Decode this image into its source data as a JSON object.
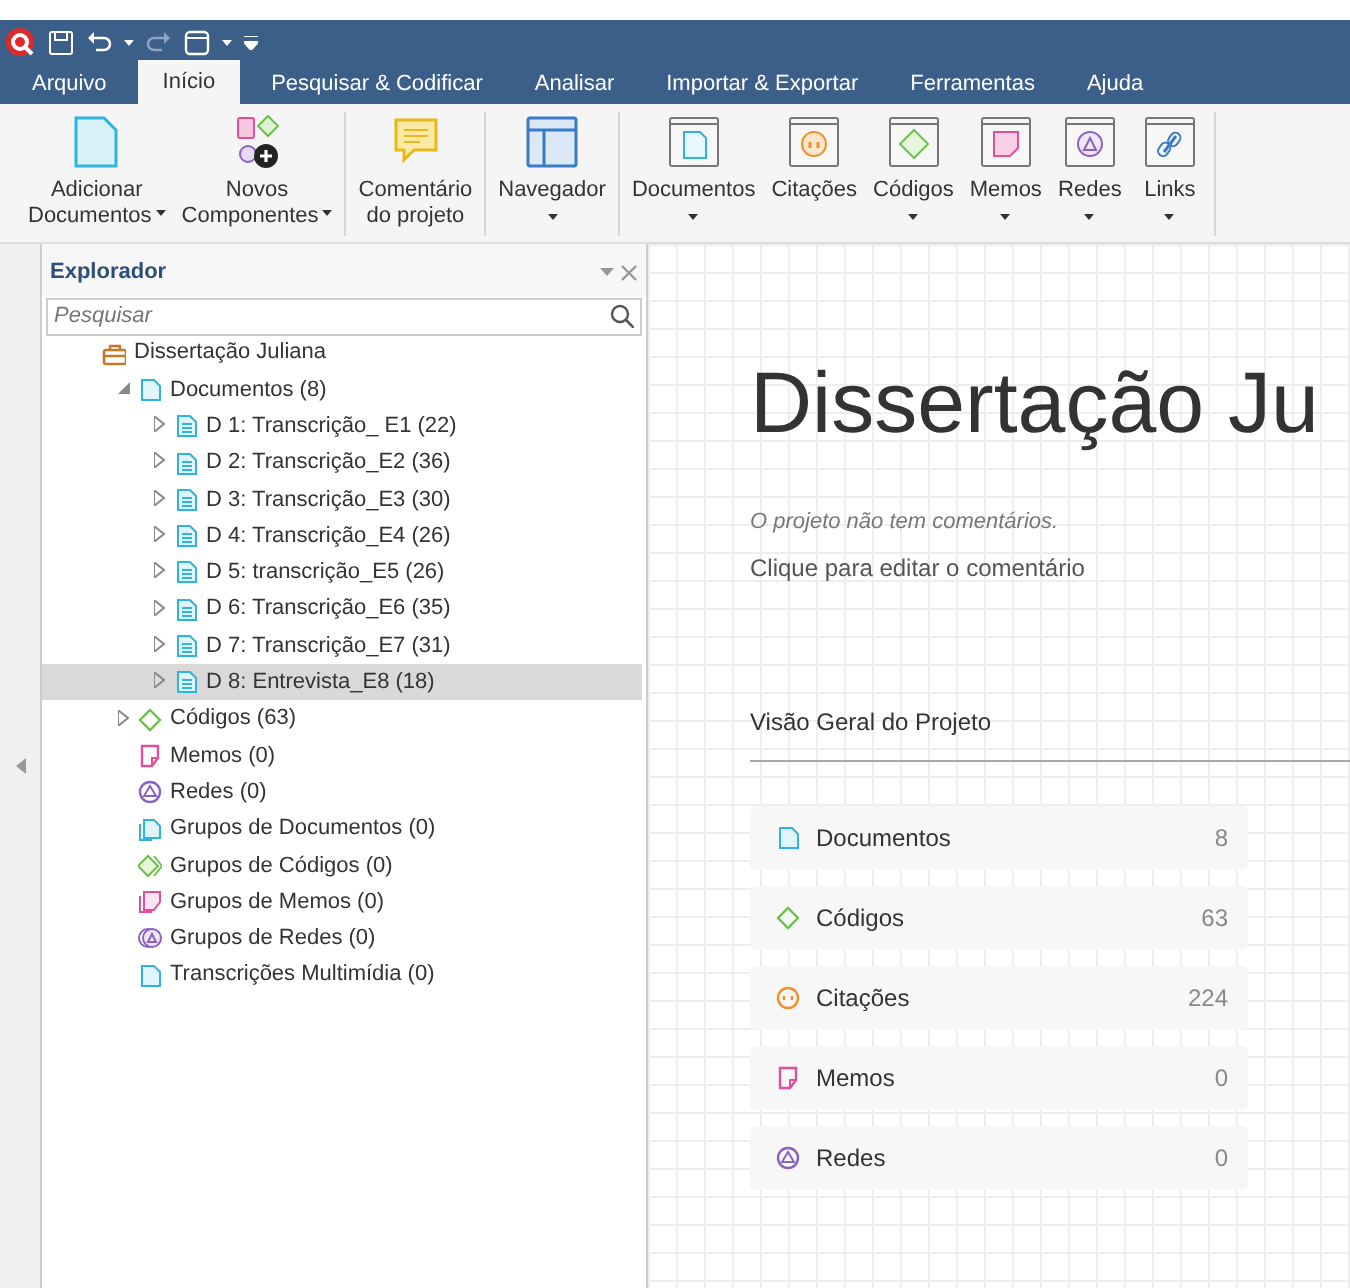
{
  "ribbon_tabs": [
    {
      "label": "Arquivo",
      "selected": false
    },
    {
      "label": "Início",
      "selected": true
    },
    {
      "label": "Pesquisar & Codificar",
      "selected": false
    },
    {
      "label": "Analisar",
      "selected": false
    },
    {
      "label": "Importar & Exportar",
      "selected": false
    },
    {
      "label": "Ferramentas",
      "selected": false
    },
    {
      "label": "Ajuda",
      "selected": false
    }
  ],
  "ribbon_groups": [
    [
      {
        "kind": "add-doc",
        "lines": [
          "Adicionar",
          "Documentos"
        ],
        "dropdown": true
      },
      {
        "kind": "new-items",
        "lines": [
          "Novos",
          "Componentes"
        ],
        "dropdown": true
      }
    ],
    [
      {
        "kind": "comment",
        "lines": [
          "Comentário",
          "do projeto"
        ],
        "dropdown": false
      }
    ],
    [
      {
        "kind": "navigator",
        "lines": [
          "Navegador"
        ],
        "dropdown": true
      }
    ],
    [
      {
        "kind": "doc-win",
        "lines": [
          "Documentos"
        ],
        "dropdown": true
      },
      {
        "kind": "quote-win",
        "lines": [
          "Citações"
        ],
        "dropdown": false
      },
      {
        "kind": "code-win",
        "lines": [
          "Códigos"
        ],
        "dropdown": true
      },
      {
        "kind": "memo-win",
        "lines": [
          "Memos"
        ],
        "dropdown": true
      },
      {
        "kind": "net-win",
        "lines": [
          "Redes"
        ],
        "dropdown": true
      },
      {
        "kind": "link-win",
        "lines": [
          "Links"
        ],
        "dropdown": true
      }
    ]
  ],
  "explorer": {
    "title": "Explorador",
    "search": {
      "placeholder": "Pesquisar"
    },
    "tree": [
      {
        "kind": "project",
        "label": "Dissertação Juliana",
        "selected": false,
        "children": [
          {
            "kind": "docs",
            "label": "Documentos (8)",
            "selected": false,
            "expanded": true,
            "children": [
              {
                "kind": "doc",
                "label": "D 1: Transcrição_ E1 (22)",
                "selected": false,
                "expanded": false
              },
              {
                "kind": "doc",
                "label": "D 2: Transcrição_E2 (36)",
                "selected": false,
                "expanded": false
              },
              {
                "kind": "doc",
                "label": "D 3: Transcrição_E3 (30)",
                "selected": false,
                "expanded": false
              },
              {
                "kind": "doc",
                "label": "D 4: Transcrição_E4 (26)",
                "selected": false,
                "expanded": false
              },
              {
                "kind": "doc",
                "label": "D 5: transcrição_E5 (26)",
                "selected": false,
                "expanded": false
              },
              {
                "kind": "doc",
                "label": "D 6: Transcrição_E6 (35)",
                "selected": false,
                "expanded": false
              },
              {
                "kind": "doc",
                "label": "D 7: Transcrição_E7 (31)",
                "selected": false,
                "expanded": false
              },
              {
                "kind": "doc",
                "label": "D 8: Entrevista_E8 (18)",
                "selected": true,
                "expanded": false
              }
            ]
          },
          {
            "kind": "code",
            "label": "Códigos (63)",
            "selected": false,
            "expanded": false
          },
          {
            "kind": "memo",
            "label": "Memos (0)",
            "selected": false
          },
          {
            "kind": "network",
            "label": "Redes (0)",
            "selected": false
          },
          {
            "kind": "doc-group",
            "label": "Grupos de Documentos (0)",
            "selected": false
          },
          {
            "kind": "code-group",
            "label": "Grupos de Códigos (0)",
            "selected": false
          },
          {
            "kind": "memo-group",
            "label": "Grupos de Memos (0)",
            "selected": false
          },
          {
            "kind": "network-group",
            "label": "Grupos de Redes (0)",
            "selected": false
          },
          {
            "kind": "docs",
            "label": "Transcrições Multimídia (0)",
            "selected": false
          }
        ]
      }
    ]
  },
  "project": {
    "title": "Dissertação Ju",
    "comment_status": "O projeto não tem comentários.",
    "edit_hint": "Clique para editar o comentário",
    "overview_title": "Visão Geral do Projeto",
    "overview": [
      {
        "kind": "docs",
        "label": "Documentos",
        "count": "8"
      },
      {
        "kind": "code",
        "label": "Códigos",
        "count": "63"
      },
      {
        "kind": "quote",
        "label": "Citações",
        "count": "224"
      },
      {
        "kind": "memo",
        "label": "Memos",
        "count": "0"
      },
      {
        "kind": "network",
        "label": "Redes",
        "count": "0"
      }
    ]
  }
}
